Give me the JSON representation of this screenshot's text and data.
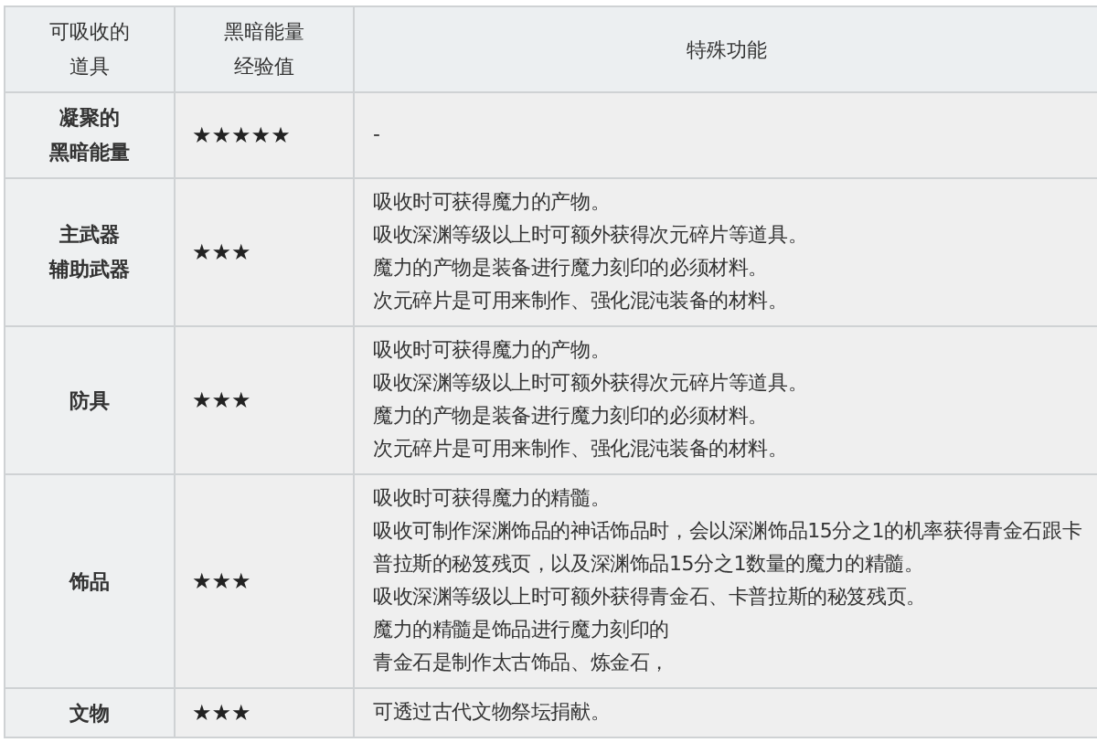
{
  "table": {
    "columns": [
      {
        "lines": [
          "可吸收的",
          "道具"
        ]
      },
      {
        "lines": [
          "黑暗能量",
          "经验值"
        ]
      },
      {
        "lines": [
          "特殊功能"
        ]
      }
    ],
    "rows": [
      {
        "item": [
          "凝聚的",
          "黑暗能量"
        ],
        "stars": 5,
        "effects": [
          "-"
        ]
      },
      {
        "item": [
          "主武器",
          "辅助武器"
        ],
        "stars": 3,
        "effects": [
          "吸收时可获得魔力的产物。",
          "吸收深渊等级以上时可额外获得次元碎片等道具。",
          "魔力的产物是装备进行魔力刻印的必须材料。",
          "次元碎片是可用来制作、强化混沌装备的材料。"
        ]
      },
      {
        "item": [
          "防具"
        ],
        "stars": 3,
        "effects": [
          "吸收时可获得魔力的产物。",
          "吸收深渊等级以上时可额外获得次元碎片等道具。",
          "魔力的产物是装备进行魔力刻印的必须材料。",
          "次元碎片是可用来制作、强化混沌装备的材料。"
        ]
      },
      {
        "item": [
          "饰品"
        ],
        "stars": 3,
        "effects": [
          "吸收时可获得魔力的精髓。",
          "吸收可制作深渊饰品的神话饰品时，会以深渊饰品15分之1的机率获得青金石跟卡普拉斯的秘笈残页，以及深渊饰品15分之1数量的魔力的精髓。",
          "吸收深渊等级以上时可额外获得青金石、卡普拉斯的秘笈残页。",
          "魔力的精髓是饰品进行魔力刻印的",
          "青金石是制作太古饰品、炼金石，"
        ]
      },
      {
        "item": [
          "文物"
        ],
        "stars": 3,
        "effects": [
          "可透过古代文物祭坛捐献。"
        ]
      }
    ]
  }
}
